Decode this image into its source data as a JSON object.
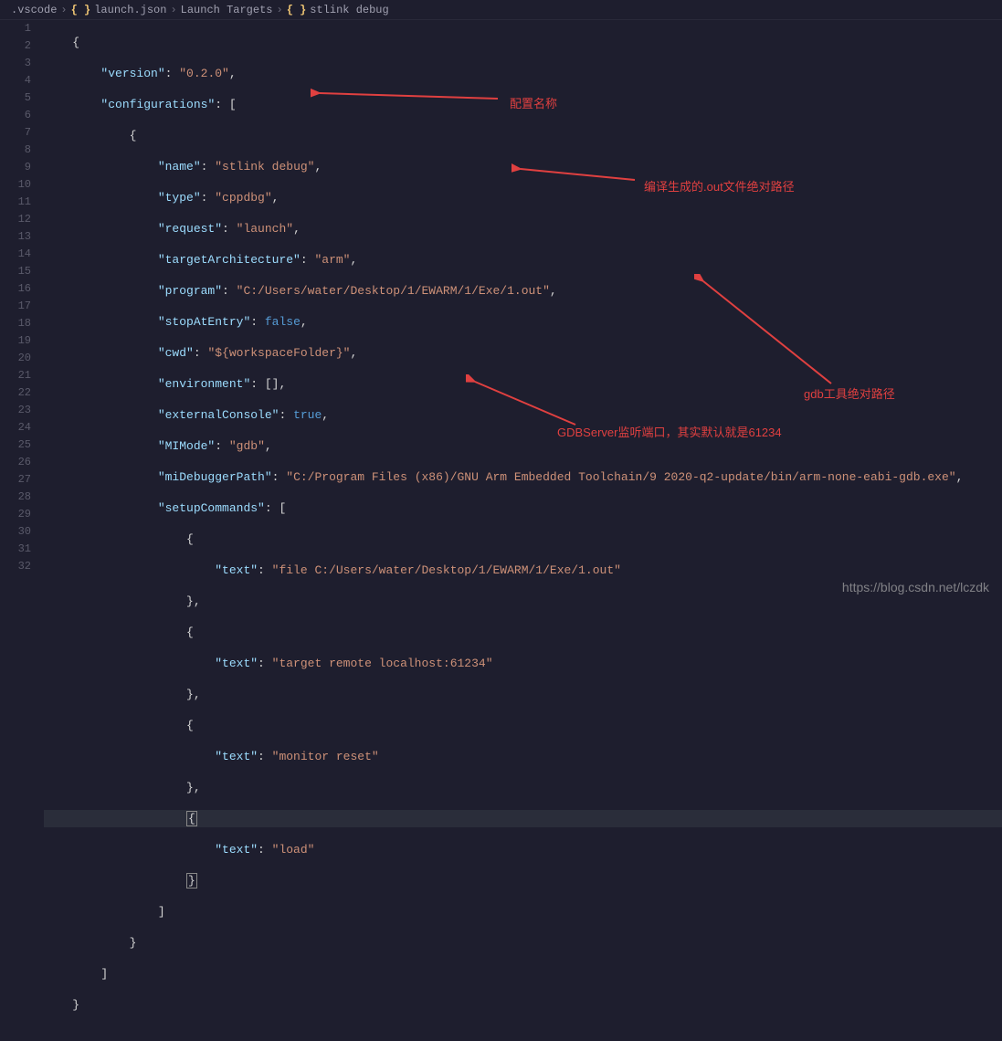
{
  "breadcrumb": {
    "folder": ".vscode",
    "file": "launch.json",
    "section": "Launch Targets",
    "item": "stlink debug"
  },
  "lines": {
    "l1": "{",
    "l2_k": "\"version\"",
    "l2_v": "\"0.2.0\"",
    "l3_k": "\"configurations\"",
    "l5_k": "\"name\"",
    "l5_v": "\"stlink debug\"",
    "l6_k": "\"type\"",
    "l6_v": "\"cppdbg\"",
    "l7_k": "\"request\"",
    "l7_v": "\"launch\"",
    "l8_k": "\"targetArchitecture\"",
    "l8_v": "\"arm\"",
    "l9_k": "\"program\"",
    "l9_v": "\"C:/Users/water/Desktop/1/EWARM/1/Exe/1.out\"",
    "l10_k": "\"stopAtEntry\"",
    "l10_v": "false",
    "l11_k": "\"cwd\"",
    "l11_v": "\"${workspaceFolder}\"",
    "l12_k": "\"environment\"",
    "l13_k": "\"externalConsole\"",
    "l13_v": "true",
    "l14_k": "\"MIMode\"",
    "l14_v": "\"gdb\"",
    "l15_k": "\"miDebuggerPath\"",
    "l15_v": "\"C:/Program Files (x86)/GNU Arm Embedded Toolchain/9 2020-q2-update/bin/arm-none-eabi-gdb.exe\"",
    "l16_k": "\"setupCommands\"",
    "l18_k": "\"text\"",
    "l18_v": "\"file C:/Users/water/Desktop/1/EWARM/1/Exe/1.out\"",
    "l21_k": "\"text\"",
    "l21_v": "\"target remote localhost:61234\"",
    "l24_k": "\"text\"",
    "l24_v": "\"monitor reset\"",
    "l27_k": "\"text\"",
    "l27_v": "\"load\""
  },
  "annotations": {
    "a1": "配置名称",
    "a2": "编译生成的.out文件绝对路径",
    "a3": "gdb工具绝对路径",
    "a4": "GDBServer监听端口，其实默认就是61234"
  },
  "watermark": "https://blog.csdn.net/lczdk"
}
